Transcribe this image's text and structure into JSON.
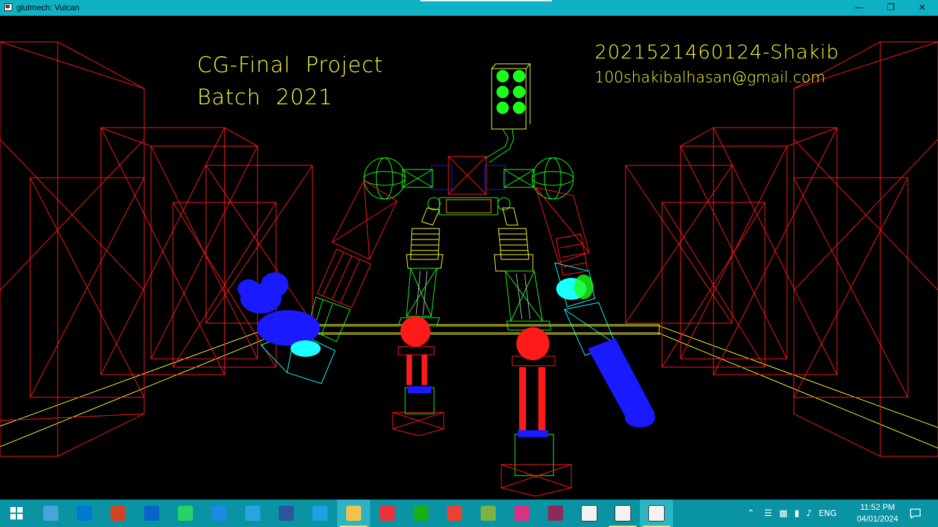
{
  "window": {
    "title": "glutmech: Vulcan",
    "controls": {
      "minimize": "—",
      "maximize": "❐",
      "close": "✕"
    }
  },
  "scene": {
    "background": "#000000",
    "colors": {
      "buildings": "#ff1a1a",
      "floor_lines": "#ffff33",
      "head": "#ffff33",
      "joints": "#1aff1a",
      "hands": "#1a1aff",
      "cyan_parts": "#1affff"
    },
    "overlay_text": {
      "line1": "CG-Final  Project",
      "line2": "Batch  2021",
      "student_id": "2021521460124-Shakib",
      "email": "100shakibalhasan@gmail.com"
    }
  },
  "taskbar": {
    "start_icon": "windows-start-icon",
    "apps": [
      {
        "name": "this-pc-icon",
        "color": "#4aa3df"
      },
      {
        "name": "microsoft-store-icon",
        "color": "#0078d4"
      },
      {
        "name": "powerpoint-icon",
        "color": "#d04423"
      },
      {
        "name": "mail-icon",
        "color": "#0a64c8"
      },
      {
        "name": "whatsapp-icon",
        "color": "#25d366"
      },
      {
        "name": "app-blue-icon",
        "color": "#1e88e5"
      },
      {
        "name": "telegram-icon",
        "color": "#2aa3e3"
      },
      {
        "name": "word-icon",
        "color": "#2b579a"
      },
      {
        "name": "edge-icon",
        "color": "#1fa0e0"
      },
      {
        "name": "file-explorer-icon",
        "color": "#f2c14e"
      },
      {
        "name": "creative-cloud-icon",
        "color": "#e8333a"
      },
      {
        "name": "wechat-icon",
        "color": "#1aad19"
      },
      {
        "name": "chrome-icon",
        "color": "#e94235"
      },
      {
        "name": "colorful-app-icon",
        "color": "#7cb342"
      },
      {
        "name": "wps-icon",
        "color": "#d63384"
      },
      {
        "name": "winrar-icon",
        "color": "#8e2a5a"
      },
      {
        "name": "notion-icon",
        "color": "#ffffff"
      },
      {
        "name": "window-app-icon",
        "color": "#ffffff"
      },
      {
        "name": "glut-app-icon",
        "color": "#ffffff"
      }
    ],
    "tray": {
      "language": "ENG",
      "time": "11:52 PM",
      "date": "04/01/2024"
    }
  }
}
